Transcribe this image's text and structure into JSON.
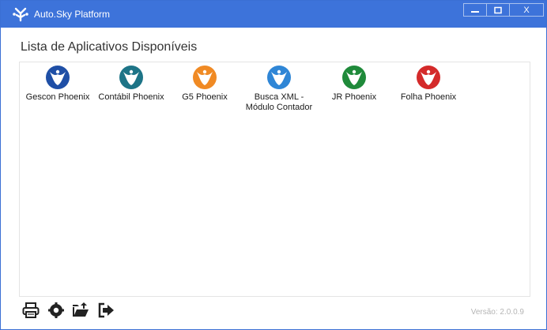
{
  "window": {
    "title": "Auto.Sky Platform",
    "controls": {
      "minimize": "—",
      "maximize": "□",
      "close": "X"
    }
  },
  "main": {
    "heading": "Lista de Aplicativos Disponíveis",
    "apps": [
      {
        "label": "Gescon Phoenix",
        "icon": "phoenix-icon",
        "color": "#1f4fa6"
      },
      {
        "label": "Contábil Phoenix",
        "icon": "phoenix-icon",
        "color": "#1d7487"
      },
      {
        "label": "G5 Phoenix",
        "icon": "phoenix-icon",
        "color": "#f08a24"
      },
      {
        "label": "Busca XML -\nMódulo Contador",
        "icon": "phoenix-icon",
        "color": "#2f86d6"
      },
      {
        "label": "JR Phoenix",
        "icon": "phoenix-icon",
        "color": "#1f8a3a"
      },
      {
        "label": "Folha Phoenix",
        "icon": "phoenix-icon",
        "color": "#d42a2a"
      }
    ]
  },
  "footer": {
    "icons": [
      "printer-icon",
      "gear-icon",
      "folder-upload-icon",
      "exit-icon"
    ],
    "version": "Versão: 2.0.0.9"
  },
  "colors": {
    "titlebar": "#3d73da",
    "accent": "#3d73da"
  }
}
